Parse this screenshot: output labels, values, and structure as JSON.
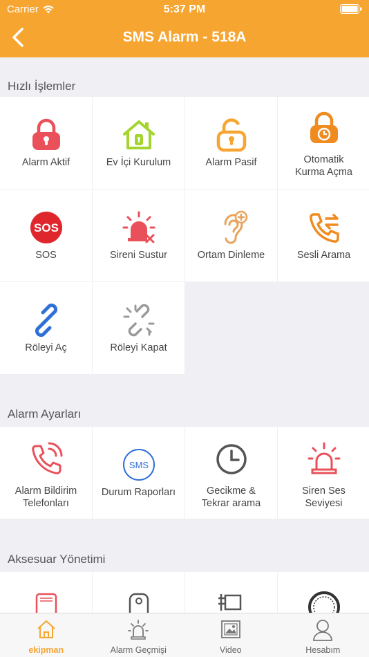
{
  "status_bar": {
    "carrier": "Carrier",
    "time": "5:37 PM"
  },
  "navbar": {
    "title": "SMS Alarm - 518A"
  },
  "sections": {
    "quick": {
      "title": "Hızlı İşlemler"
    },
    "settings": {
      "title": "Alarm Ayarları"
    },
    "accessory": {
      "title": "Aksesuar Yönetimi"
    }
  },
  "quick_actions": [
    {
      "label": "Alarm Aktif",
      "icon": "lock-closed-icon",
      "color": "#e9505a"
    },
    {
      "label": "Ev İçi Kurulum",
      "icon": "home-lock-icon",
      "color": "#a4d42e"
    },
    {
      "label": "Alarm Pasif",
      "icon": "lock-open-icon",
      "color": "#f6a531"
    },
    {
      "label": "Otomatik\nKurma Açma",
      "icon": "lock-timer-icon",
      "color": "#f08b1f"
    },
    {
      "label": "SOS",
      "icon": "sos-icon",
      "color": "#e0262d"
    },
    {
      "label": "Sireni Sustur",
      "icon": "siren-mute-icon",
      "color": "#e9505a"
    },
    {
      "label": "Ortam Dinleme",
      "icon": "ear-icon",
      "color": "#e8a35c"
    },
    {
      "label": "Sesli Arama",
      "icon": "phone-transfer-icon",
      "color": "#f08b1f"
    },
    {
      "label": "Röleyi Aç",
      "icon": "link-icon",
      "color": "#2f6fd8"
    },
    {
      "label": "Röleyi Kapat",
      "icon": "broken-link-icon",
      "color": "#999999"
    }
  ],
  "alarm_settings": [
    {
      "label": "Alarm Bildirim\nTelefonları",
      "icon": "phone-ringing-icon",
      "color": "#e9505a"
    },
    {
      "label": "Durum Raporları",
      "icon": "sms-icon",
      "color": "#2f6fd8",
      "badge": "SMS"
    },
    {
      "label": "Gecikme &\nTekrar arama",
      "icon": "clock-icon",
      "color": "#555555"
    },
    {
      "label": "Siren Ses\nSeviyesi",
      "icon": "siren-icon",
      "color": "#e9505a"
    }
  ],
  "tabs": [
    {
      "label": "ekipman",
      "icon": "home-icon",
      "active": true
    },
    {
      "label": "Alarm Geçmişi",
      "icon": "alarm-history-icon",
      "active": false
    },
    {
      "label": "Video",
      "icon": "video-icon",
      "active": false
    },
    {
      "label": "Hesabım",
      "icon": "user-icon",
      "active": false
    }
  ],
  "colors": {
    "accent": "#f6a531",
    "background": "#efeff4"
  }
}
